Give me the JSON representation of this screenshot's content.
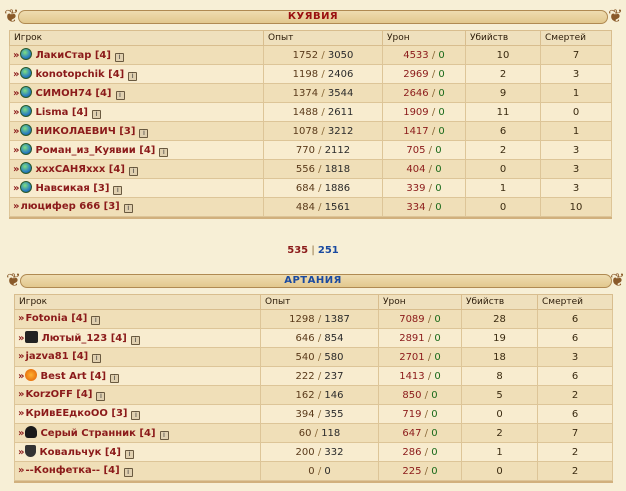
{
  "teams": [
    {
      "name": "КУЯВИЯ",
      "headers": [
        "Игрок",
        "Опыт",
        "Урон",
        "Убийств",
        "Смертей"
      ],
      "rows": [
        {
          "icon": "globe",
          "name": "ЛакиСтар [4]",
          "exp_a": "1752",
          "exp_b": "3050",
          "dmg_a": "4533",
          "dmg_b": "0",
          "kills": "10",
          "deaths": "7"
        },
        {
          "icon": "globe",
          "name": "konotopchik [4]",
          "exp_a": "1198",
          "exp_b": "2406",
          "dmg_a": "2969",
          "dmg_b": "0",
          "kills": "2",
          "deaths": "3"
        },
        {
          "icon": "globe",
          "name": "СИМОН74 [4]",
          "exp_a": "1374",
          "exp_b": "3544",
          "dmg_a": "2646",
          "dmg_b": "0",
          "kills": "9",
          "deaths": "1"
        },
        {
          "icon": "globe",
          "name": "Lisma [4]",
          "exp_a": "1488",
          "exp_b": "2611",
          "dmg_a": "1909",
          "dmg_b": "0",
          "kills": "11",
          "deaths": "0"
        },
        {
          "icon": "globe",
          "name": "НИКОЛАЕВИЧ [3]",
          "exp_a": "1078",
          "exp_b": "3212",
          "dmg_a": "1417",
          "dmg_b": "0",
          "kills": "6",
          "deaths": "1"
        },
        {
          "icon": "globe",
          "name": "Роман_из_Куявии [4]",
          "exp_a": "770",
          "exp_b": "2112",
          "dmg_a": "705",
          "dmg_b": "0",
          "kills": "2",
          "deaths": "3"
        },
        {
          "icon": "globe",
          "name": "xxxСАНЯxxx [4]",
          "exp_a": "556",
          "exp_b": "1818",
          "dmg_a": "404",
          "dmg_b": "0",
          "kills": "0",
          "deaths": "3"
        },
        {
          "icon": "globe",
          "name": "Навсикая [3]",
          "exp_a": "684",
          "exp_b": "1886",
          "dmg_a": "339",
          "dmg_b": "0",
          "kills": "1",
          "deaths": "3"
        },
        {
          "icon": "",
          "name": "люцифер 666 [3]",
          "exp_a": "484",
          "exp_b": "1561",
          "dmg_a": "334",
          "dmg_b": "0",
          "kills": "0",
          "deaths": "10"
        }
      ]
    },
    {
      "name": "АРТАНИЯ",
      "headers": [
        "Игрок",
        "Опыт",
        "Урон",
        "Убийств",
        "Смертей"
      ],
      "rows": [
        {
          "icon": "",
          "name": "Fotonia [4]",
          "exp_a": "1298",
          "exp_b": "1387",
          "dmg_a": "7089",
          "dmg_b": "0",
          "kills": "28",
          "deaths": "6"
        },
        {
          "icon": "bat",
          "name": "Лютый_123 [4]",
          "exp_a": "646",
          "exp_b": "854",
          "dmg_a": "2891",
          "dmg_b": "0",
          "kills": "19",
          "deaths": "6"
        },
        {
          "icon": "",
          "name": "jazva81 [4]",
          "exp_a": "540",
          "exp_b": "580",
          "dmg_a": "2701",
          "dmg_b": "0",
          "kills": "18",
          "deaths": "3"
        },
        {
          "icon": "sun",
          "name": "Best Art [4]",
          "exp_a": "222",
          "exp_b": "237",
          "dmg_a": "1413",
          "dmg_b": "0",
          "kills": "8",
          "deaths": "6"
        },
        {
          "icon": "",
          "name": "KorzOFF [4]",
          "exp_a": "162",
          "exp_b": "146",
          "dmg_a": "850",
          "dmg_b": "0",
          "kills": "5",
          "deaths": "2"
        },
        {
          "icon": "",
          "name": "КрИвЕЕдкоОО [3]",
          "exp_a": "394",
          "exp_b": "355",
          "dmg_a": "719",
          "dmg_b": "0",
          "kills": "0",
          "deaths": "6"
        },
        {
          "icon": "paw",
          "name": "Серый Странник [4]",
          "exp_a": "60",
          "exp_b": "118",
          "dmg_a": "647",
          "dmg_b": "0",
          "kills": "2",
          "deaths": "7"
        },
        {
          "icon": "shield",
          "name": "Ковальчук [4]",
          "exp_a": "200",
          "exp_b": "332",
          "dmg_a": "286",
          "dmg_b": "0",
          "kills": "1",
          "deaths": "2"
        },
        {
          "icon": "",
          "name": "--Конфетка-- [4]",
          "exp_a": "0",
          "exp_b": "0",
          "dmg_a": "225",
          "dmg_b": "0",
          "kills": "0",
          "deaths": "2"
        }
      ]
    }
  ],
  "totals": {
    "a": "535",
    "sep": "|",
    "b": "251"
  },
  "ui": {
    "arrow": "»",
    "exp_sep": "/",
    "info_glyph": "i"
  }
}
